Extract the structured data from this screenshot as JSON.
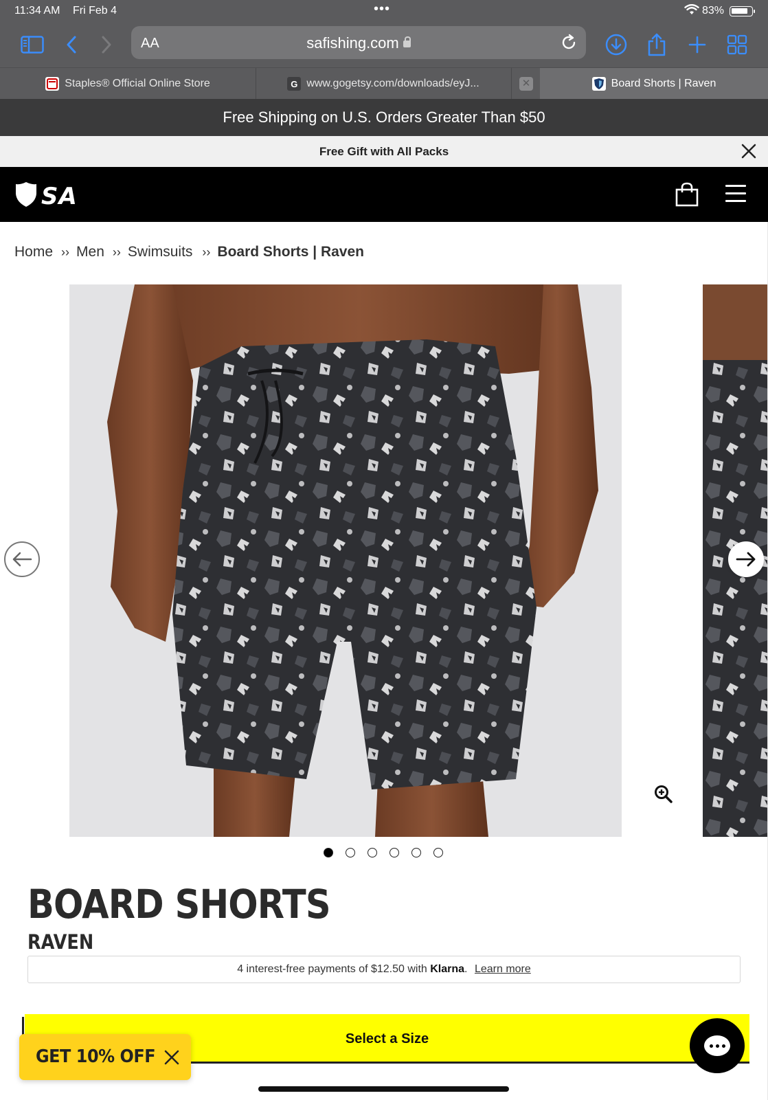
{
  "status_bar": {
    "time": "11:34 AM",
    "date": "Fri Feb 4",
    "battery": "83%"
  },
  "browser": {
    "text_size_label": "AA",
    "url": "safishing.com",
    "tabs": [
      {
        "label": "Staples® Official Online Store",
        "favicon": "staples-icon"
      },
      {
        "label": "www.gogetsy.com/downloads/eyJ...",
        "favicon_text": "G"
      },
      {
        "label": "Board Shorts | Raven",
        "favicon": "sa-icon",
        "active": true
      }
    ]
  },
  "site": {
    "shipping_banner": "Free Shipping on U.S. Orders Greater Than $50",
    "gift_banner": "Free Gift with All Packs",
    "logo_text": "SA",
    "breadcrumb": {
      "home": "Home",
      "men": "Men",
      "swimsuits": "Swimsuits",
      "current": "Board Shorts | Raven"
    },
    "gallery": {
      "image_count": 6,
      "active_index": 0
    },
    "product": {
      "title": "BOARD SHORTS",
      "subtitle": "RAVEN"
    },
    "klarna": {
      "text": "4 interest-free payments of $12.50 with",
      "brand": "Klarna",
      "suffix": ".",
      "link": "Learn more"
    },
    "select_size_label": "Select a Size",
    "promo_label": "GET 10% OFF"
  },
  "colors": {
    "browser_chrome": "#5b5b5d",
    "shipping_banner_bg": "#3a3a3b",
    "nav_bg": "#000000",
    "cta_yellow": "#ffff00",
    "promo_yellow": "#ffd21c"
  }
}
